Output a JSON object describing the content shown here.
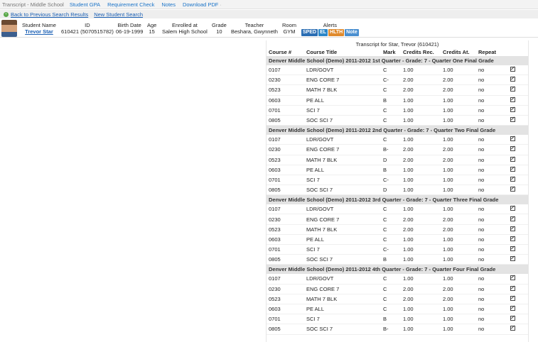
{
  "nav": {
    "title": "Transcript - Middle School",
    "links": [
      "Student GPA",
      "Requirement Check",
      "Notes",
      "Download PDF"
    ],
    "pdf_sep": "·"
  },
  "actions": {
    "back": "Back to Previous Search Results",
    "new_search": "New Student Search"
  },
  "student": {
    "labels": {
      "name": "Student Name",
      "id": "ID",
      "birth": "Birth Date",
      "age": "Age",
      "enrolled": "Enrolled at",
      "grade": "Grade",
      "teacher": "Teacher",
      "room": "Room",
      "alerts": "Alerts"
    },
    "name": "Trevor Star",
    "id": "610421 (5070515782)",
    "birth": "06-19-1999",
    "age": "15",
    "enrolled": "Salem High School",
    "grade": "10",
    "teacher": "Beshara, Gwynneth",
    "room": "GYM",
    "alerts": [
      {
        "label": "SPED",
        "color": "#2a6db3"
      },
      {
        "label": "EL",
        "color": "#2a86c8"
      },
      {
        "label": "HLTH",
        "color": "#e08a2c"
      },
      {
        "label": "Note",
        "color": "#4a8fd0"
      }
    ]
  },
  "transcript": {
    "title": "Transcript for Star, Trevor (610421)",
    "columns": [
      "Course #",
      "Course Title",
      "Mark",
      "Credits Rec.",
      "Credits At.",
      "Repeat"
    ],
    "sections": [
      {
        "heading": "Denver Middle School (Demo) 2011-2012 1st Quarter - Grade: 7 - Quarter One Final Grade",
        "rows": [
          [
            "0107",
            "LDR/GOVT",
            "C",
            "1.00",
            "1.00",
            "no"
          ],
          [
            "0230",
            "ENG CORE 7",
            "C-",
            "2.00",
            "2.00",
            "no"
          ],
          [
            "0523",
            "MATH 7 BLK",
            "C",
            "2.00",
            "2.00",
            "no"
          ],
          [
            "0603",
            "PE ALL",
            "B",
            "1.00",
            "1.00",
            "no"
          ],
          [
            "0701",
            "SCI 7",
            "C",
            "1.00",
            "1.00",
            "no"
          ],
          [
            "0805",
            "SOC SCI 7",
            "C",
            "1.00",
            "1.00",
            "no"
          ]
        ]
      },
      {
        "heading": "Denver Middle School (Demo) 2011-2012 2nd Quarter - Grade: 7 - Quarter Two Final Grade",
        "rows": [
          [
            "0107",
            "LDR/GOVT",
            "C",
            "1.00",
            "1.00",
            "no"
          ],
          [
            "0230",
            "ENG CORE 7",
            "B-",
            "2.00",
            "2.00",
            "no"
          ],
          [
            "0523",
            "MATH 7 BLK",
            "D",
            "2.00",
            "2.00",
            "no"
          ],
          [
            "0603",
            "PE ALL",
            "B",
            "1.00",
            "1.00",
            "no"
          ],
          [
            "0701",
            "SCI 7",
            "C-",
            "1.00",
            "1.00",
            "no"
          ],
          [
            "0805",
            "SOC SCI 7",
            "D",
            "1.00",
            "1.00",
            "no"
          ]
        ]
      },
      {
        "heading": "Denver Middle School (Demo) 2011-2012 3rd Quarter - Grade: 7 - Quarter Three Final Grade",
        "rows": [
          [
            "0107",
            "LDR/GOVT",
            "C",
            "1.00",
            "1.00",
            "no"
          ],
          [
            "0230",
            "ENG CORE 7",
            "C",
            "2.00",
            "2.00",
            "no"
          ],
          [
            "0523",
            "MATH 7 BLK",
            "C",
            "2.00",
            "2.00",
            "no"
          ],
          [
            "0603",
            "PE ALL",
            "C",
            "1.00",
            "1.00",
            "no"
          ],
          [
            "0701",
            "SCI 7",
            "C-",
            "1.00",
            "1.00",
            "no"
          ],
          [
            "0805",
            "SOC SCI 7",
            "B",
            "1.00",
            "1.00",
            "no"
          ]
        ]
      },
      {
        "heading": "Denver Middle School (Demo) 2011-2012 4th Quarter - Grade: 7 - Quarter Four Final Grade",
        "rows": [
          [
            "0107",
            "LDR/GOVT",
            "C",
            "1.00",
            "1.00",
            "no"
          ],
          [
            "0230",
            "ENG CORE 7",
            "C",
            "2.00",
            "2.00",
            "no"
          ],
          [
            "0523",
            "MATH 7 BLK",
            "C",
            "2.00",
            "2.00",
            "no"
          ],
          [
            "0603",
            "PE ALL",
            "C",
            "1.00",
            "1.00",
            "no"
          ],
          [
            "0701",
            "SCI 7",
            "B",
            "1.00",
            "1.00",
            "no"
          ],
          [
            "0805",
            "SOC SCI 7",
            "B-",
            "1.00",
            "1.00",
            "no"
          ]
        ]
      }
    ]
  }
}
